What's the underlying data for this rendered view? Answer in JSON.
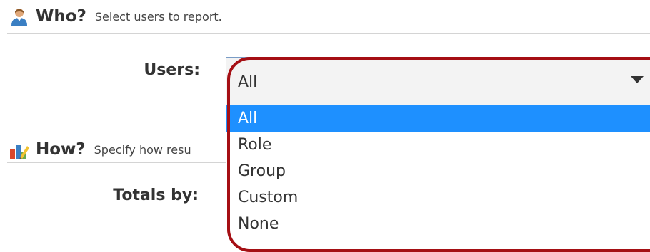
{
  "who": {
    "title": "Who?",
    "description": "Select users to report."
  },
  "how": {
    "title": "How?",
    "description": "Specify how resu"
  },
  "users_field": {
    "label": "Users:",
    "selected": "All",
    "options": [
      "All",
      "Role",
      "Group",
      "Custom",
      "None"
    ]
  },
  "totals_field": {
    "label": "Totals by:"
  },
  "colors": {
    "selected_option": "#1e90ff",
    "highlight": "#a50f14",
    "select_border": "#7a9cc6"
  },
  "icons": {
    "who": "users-icon",
    "how": "chart-icon",
    "dropdown": "caret-down-icon"
  }
}
